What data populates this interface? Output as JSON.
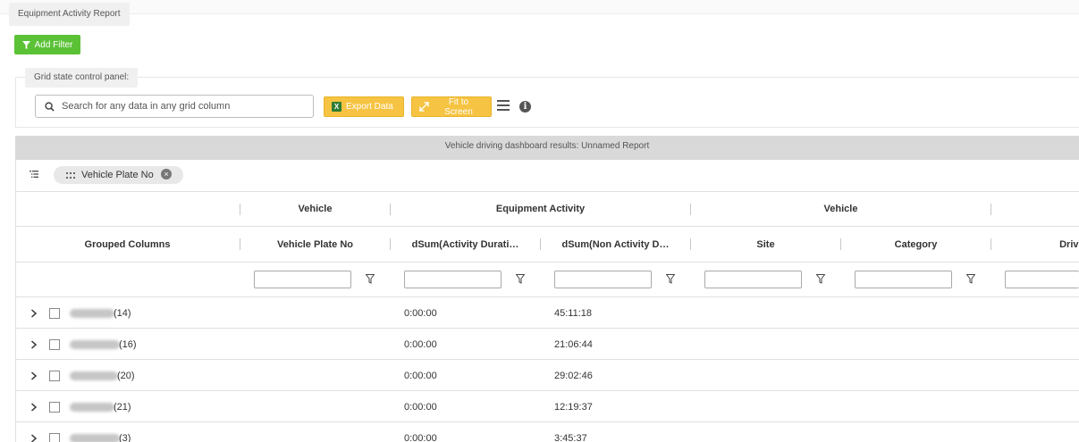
{
  "report_tab": "Equipment Activity Report",
  "add_filter_label": "Add Filter",
  "panel": {
    "legend": "Grid state control panel:",
    "search_placeholder": "Search for any data in any grid column",
    "export_label": "Export Data",
    "fit_label": "Fit to Screen"
  },
  "grid": {
    "title": "Vehicle driving dashboard results: Unnamed Report",
    "group_chip": "Vehicle Plate No",
    "bands": [
      "Vehicle",
      "Equipment Activity",
      "Vehicle"
    ],
    "columns": [
      "Grouped Columns",
      "Vehicle Plate No",
      "dSum(Activity Durati…",
      "dSum(Non Activity D…",
      "Site",
      "Category",
      "Driver"
    ],
    "rows": [
      {
        "count": "(14)",
        "activity": "0:00:00",
        "non_activity": "45:11:18"
      },
      {
        "count": "(16)",
        "activity": "0:00:00",
        "non_activity": "21:06:44"
      },
      {
        "count": "(20)",
        "activity": "0:00:00",
        "non_activity": "29:02:46"
      },
      {
        "count": "(21)",
        "activity": "0:00:00",
        "non_activity": "12:19:37"
      },
      {
        "count": "(3)",
        "activity": "0:00:00",
        "non_activity": "3:45:37"
      }
    ]
  },
  "colors": {
    "add_filter": "#5bc236",
    "yellow_button": "#f6c342",
    "title_bar": "#d9d9d9"
  },
  "icons": [
    "filter-icon",
    "search-icon",
    "excel-icon",
    "expand-arrows-icon",
    "hamburger-menu-icon",
    "info-icon",
    "group-list-icon",
    "drag-grip-icon",
    "close-circle-icon",
    "funnel-icon",
    "chevron-right-icon"
  ]
}
